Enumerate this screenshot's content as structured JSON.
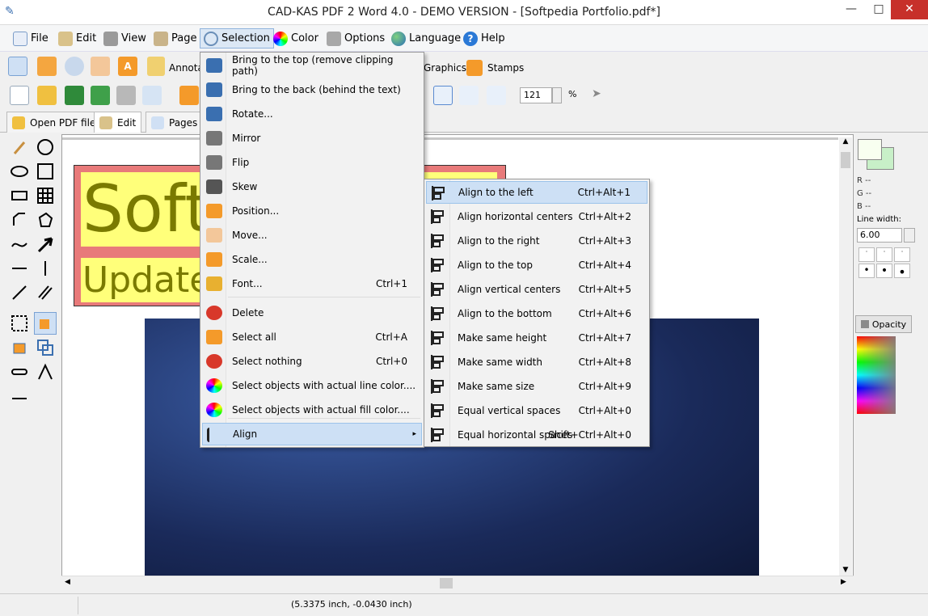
{
  "window": {
    "title": "CAD-KAS PDF 2 Word 4.0 - DEMO VERSION - [Softpedia Portfolio.pdf*]",
    "minimize": "—",
    "maximize": "□",
    "close": "✕"
  },
  "menubar": [
    {
      "label": "File",
      "icon": "file-icon"
    },
    {
      "label": "Edit",
      "icon": "edit-icon"
    },
    {
      "label": "View",
      "icon": "view-icon"
    },
    {
      "label": "Page",
      "icon": "page-icon"
    },
    {
      "label": "Selection",
      "icon": "lasso-icon"
    },
    {
      "label": "Color",
      "icon": "color-wheel-icon"
    },
    {
      "label": "Options",
      "icon": "wrench-icon"
    },
    {
      "label": "Language",
      "icon": "globe-icon"
    },
    {
      "label": "Help",
      "icon": "help-icon"
    }
  ],
  "toolbar1": {
    "annot_label": "Annota",
    "graphics_label": "Graphics",
    "stamps_label": "Stamps"
  },
  "toolbar2": {
    "zoom_value": "121",
    "zoom_unit": "%"
  },
  "tabs": [
    {
      "label": "Open PDF file"
    },
    {
      "label": "Edit"
    },
    {
      "label": "Pages"
    }
  ],
  "canvas": {
    "text_large": "Soft",
    "text_small": "Update"
  },
  "right_panel": {
    "r": "R --",
    "g": "G --",
    "b": "B --",
    "line_width_label": "Line width:",
    "line_width_value": "6.00",
    "opacity_label": "Opacity"
  },
  "status": {
    "coords": "(5.3375 inch, -0.0430 inch)"
  },
  "selection_menu": [
    {
      "label": "Bring to the top (remove clipping path)",
      "shortcut": "",
      "icon": "bring-top-icon"
    },
    {
      "label": "Bring to the back (behind the text)",
      "shortcut": "",
      "icon": "bring-back-icon"
    },
    {
      "label": "Rotate...",
      "shortcut": "",
      "icon": "rotate-icon"
    },
    {
      "label": "Mirror",
      "shortcut": "",
      "icon": "mirror-icon"
    },
    {
      "label": "Flip",
      "shortcut": "",
      "icon": "flip-icon"
    },
    {
      "label": "Skew",
      "shortcut": "",
      "icon": "skew-icon"
    },
    {
      "label": "Position...",
      "shortcut": "",
      "icon": "position-icon"
    },
    {
      "label": "Move...",
      "shortcut": "",
      "icon": "move-hand-icon"
    },
    {
      "label": "Scale...",
      "shortcut": "",
      "icon": "scale-icon"
    },
    {
      "label": "Font...",
      "shortcut": "Ctrl+1",
      "icon": "font-icon"
    },
    {
      "label": "Delete",
      "shortcut": "",
      "icon": "delete-icon"
    },
    {
      "label": "Select all",
      "shortcut": "Ctrl+A",
      "icon": "select-all-icon"
    },
    {
      "label": "Select nothing",
      "shortcut": "Ctrl+0",
      "icon": "select-nothing-icon"
    },
    {
      "label": "Select objects with actual line color....",
      "shortcut": "",
      "icon": "line-color-icon"
    },
    {
      "label": "Select objects with actual fill color....",
      "shortcut": "",
      "icon": "fill-color-icon"
    },
    {
      "label": "Align",
      "shortcut": "",
      "icon": "align-icon",
      "arrow": "▸"
    }
  ],
  "align_menu": [
    {
      "label": "Align to the left",
      "shortcut": "Ctrl+Alt+1",
      "icon": "align-left-icon"
    },
    {
      "label": "Align horizontal centers",
      "shortcut": "Ctrl+Alt+2",
      "icon": "align-hcenter-icon"
    },
    {
      "label": "Align to the right",
      "shortcut": "Ctrl+Alt+3",
      "icon": "align-right-icon"
    },
    {
      "label": "Align to the top",
      "shortcut": "Ctrl+Alt+4",
      "icon": "align-top-icon"
    },
    {
      "label": "Align vertical centers",
      "shortcut": "Ctrl+Alt+5",
      "icon": "align-vcenter-icon"
    },
    {
      "label": "Align to the bottom",
      "shortcut": "Ctrl+Alt+6",
      "icon": "align-bottom-icon"
    },
    {
      "label": "Make same height",
      "shortcut": "Ctrl+Alt+7",
      "icon": "same-height-icon"
    },
    {
      "label": "Make same width",
      "shortcut": "Ctrl+Alt+8",
      "icon": "same-width-icon"
    },
    {
      "label": "Make same size",
      "shortcut": "Ctrl+Alt+9",
      "icon": "same-size-icon"
    },
    {
      "label": "Equal vertical spaces",
      "shortcut": "Ctrl+Alt+0",
      "icon": "equal-vspace-icon"
    },
    {
      "label": "Equal horizontal spaces",
      "shortcut": "Shift+Ctrl+Alt+0",
      "icon": "equal-hspace-icon"
    }
  ],
  "colors": {
    "accent": "#cde0f5",
    "selection_box": "#e87a7a",
    "text_fill": "#ffff7a",
    "text_color": "#7a7a00"
  }
}
